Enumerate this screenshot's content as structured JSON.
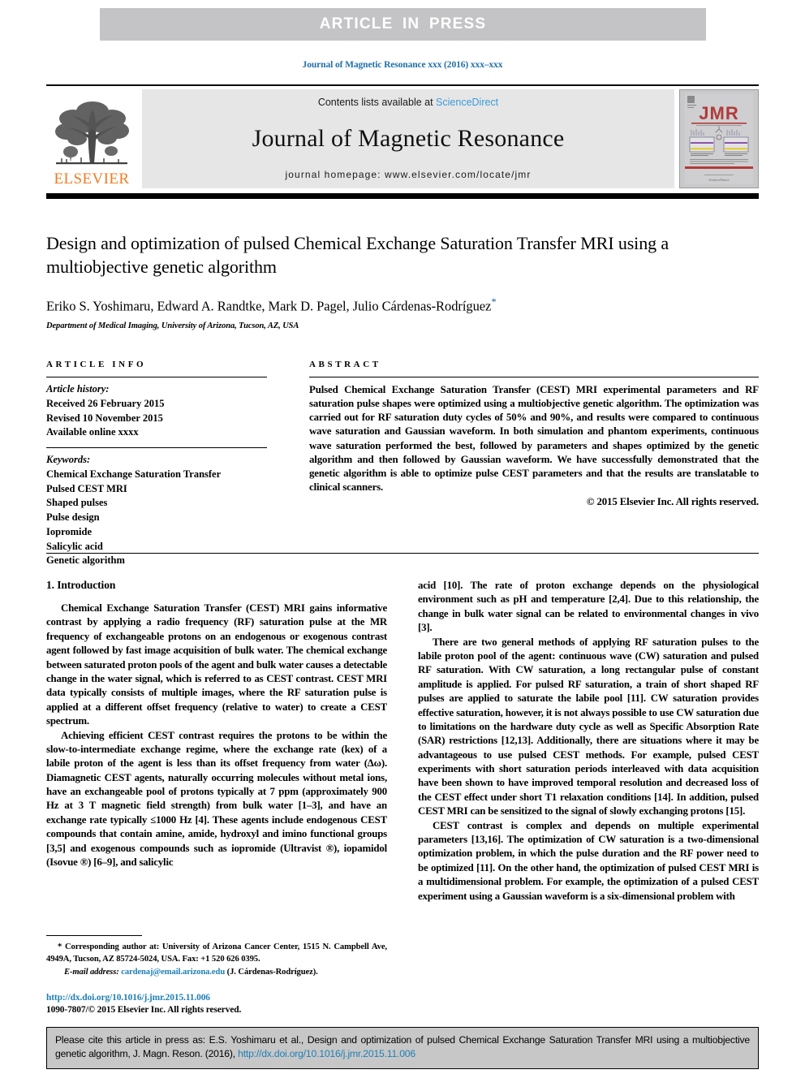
{
  "banner": {
    "text": "ARTICLE  IN  PRESS"
  },
  "running_head": {
    "text": "Journal of Magnetic Resonance xxx (2016) xxx–xxx"
  },
  "masthead": {
    "contents_prefix": "Contents lists available at ",
    "sciencedirect": "ScienceDirect",
    "journal_title": "Journal of Magnetic Resonance",
    "homepage": "journal homepage: www.elsevier.com/locate/jmr",
    "publisher_name": "ELSEVIER",
    "cover_label": "JMR"
  },
  "article": {
    "title": "Design and optimization of pulsed Chemical Exchange Saturation Transfer MRI using a multiobjective genetic algorithm",
    "authors": "Eriko S. Yoshimaru, Edward A. Randtke, Mark D. Pagel, Julio Cárdenas-Rodríguez",
    "corresponding_marker": "*",
    "affiliation": "Department of Medical Imaging, University of Arizona, Tucson, AZ, USA"
  },
  "article_info": {
    "heading": "ARTICLE INFO",
    "history_label": "Article history:",
    "history": [
      "Received 26 February 2015",
      "Revised 10 November 2015",
      "Available online xxxx"
    ],
    "keywords_label": "Keywords:",
    "keywords": [
      "Chemical Exchange Saturation Transfer",
      "Pulsed CEST MRI",
      "Shaped pulses",
      "Pulse design",
      "Iopromide",
      "Salicylic acid",
      "Genetic algorithm"
    ]
  },
  "abstract": {
    "heading": "ABSTRACT",
    "body": "Pulsed Chemical Exchange Saturation Transfer (CEST) MRI experimental parameters and RF saturation pulse shapes were optimized using a multiobjective genetic algorithm. The optimization was carried out for RF saturation duty cycles of 50% and 90%, and results were compared to continuous wave saturation and Gaussian waveform. In both simulation and phantom experiments, continuous wave saturation performed the best, followed by parameters and shapes optimized by the genetic algorithm and then followed by Gaussian waveform. We have successfully demonstrated that the genetic algorithm is able to optimize pulse CEST parameters and that the results are translatable to clinical scanners.",
    "copyright": "© 2015 Elsevier Inc. All rights reserved."
  },
  "body": {
    "section_heading": "1. Introduction",
    "left_paragraphs": [
      "Chemical Exchange Saturation Transfer (CEST) MRI gains informative contrast by applying a radio frequency (RF) saturation pulse at the MR frequency of exchangeable protons on an endogenous or exogenous contrast agent followed by fast image acquisition of bulk water. The chemical exchange between saturated proton pools of the agent and bulk water causes a detectable change in the water signal, which is referred to as CEST contrast. CEST MRI data typically consists of multiple images, where the RF saturation pulse is applied at a different offset frequency (relative to water) to create a CEST spectrum.",
      "Achieving efficient CEST contrast requires the protons to be within the slow-to-intermediate exchange regime, where the exchange rate (kex) of a labile proton of the agent is less than its offset frequency from water (Δω). Diamagnetic CEST agents, naturally occurring molecules without metal ions, have an exchangeable pool of protons typically at ⁤7 ppm (approximately 900 Hz at 3 T magnetic field strength) from bulk water [1–3], and have an exchange rate typically ≤1000 Hz [4]. These agents include endogenous CEST compounds that contain amine, amide, hydroxyl and imino functional groups [3,5] and exogenous compounds such as iopromide (Ultravist ®), iopamidol (Isovue ®) [6–9], and salicylic"
    ],
    "right_paragraphs": [
      "acid [10]. The rate of proton exchange depends on the physiological environment such as pH and temperature [2,4]. Due to this relationship, the change in bulk water signal can be related to environmental changes in vivo [3].",
      "There are two general methods of applying RF saturation pulses to the labile proton pool of the agent: continuous wave (CW) saturation and pulsed RF saturation. With CW saturation, a long rectangular pulse of constant amplitude is applied. For pulsed RF saturation, a train of short shaped RF pulses are applied to saturate the labile pool [11]. CW saturation provides effective saturation, however, it is not always possible to use CW saturation due to limitations on the hardware duty cycle as well as Specific Absorption Rate (SAR) restrictions [12,13]. Additionally, there are situations where it may be advantageous to use pulsed CEST methods. For example, pulsed CEST experiments with short saturation periods interleaved with data acquisition have been shown to have improved temporal resolution and decreased loss of the CEST effect under short T1 relaxation conditions [14]. In addition, pulsed CEST MRI can be sensitized to the signal of slowly exchanging protons [15].",
      "CEST contrast is complex and depends on multiple experimental parameters [13,16]. The optimization of CW saturation is a two-dimensional optimization problem, in which the pulse duration and the RF power need to be optimized [11]. On the other hand, the optimization of pulsed CEST MRI is a multidimensional problem. For example, the optimization of a pulsed CEST experiment using a Gaussian waveform is a six-dimensional problem with"
    ]
  },
  "footnote": {
    "corresponding": "* Corresponding author at: University of Arizona Cancer Center, 1515 N. Campbell Ave, 4949A, Tucson, AZ 85724-5024, USA. Fax: +1 520 626 0395.",
    "email_label": "E-mail address:",
    "email": "cardenaj@email.arizona.edu",
    "email_owner": "(J. Cárdenas-Rodríguez)."
  },
  "doi_block": {
    "doi_url": "http://dx.doi.org/10.1016/j.jmr.2015.11.006",
    "issn_line": "1090-7807/© 2015 Elsevier Inc. All rights reserved."
  },
  "citation_footer": {
    "prefix": "Please cite this article in press as: E.S. Yoshimaru et al., Design and optimization of pulsed Chemical Exchange Saturation Transfer MRI using a multiobjective genetic algorithm, J. Magn. Reson. (2016), ",
    "doi": "http://dx.doi.org/10.1016/j.jmr.2015.11.006"
  },
  "colors": {
    "banner_bg": "#c4c4c6",
    "link_blue": "#1f7fb5",
    "header_blue": "#1f6fa8",
    "sciencedirect_blue": "#3a9ad9",
    "elsevier_orange": "#ef7d23",
    "masthead_bg": "#e6e6e6",
    "footer_bg": "#c7c7c7"
  }
}
